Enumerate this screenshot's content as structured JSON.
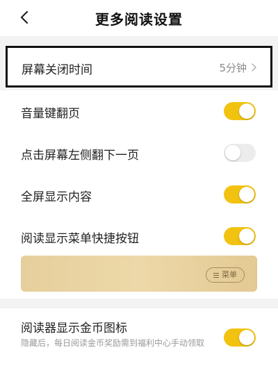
{
  "header": {
    "title": "更多阅读设置"
  },
  "screen_timeout": {
    "label": "屏幕关闭时间",
    "value": "5分钟"
  },
  "settings": [
    {
      "label": "音量键翻页",
      "on": true
    },
    {
      "label": "点击屏幕左侧翻下一页",
      "on": false
    },
    {
      "label": "全屏显示内容",
      "on": true
    },
    {
      "label": "阅读显示菜单快捷按钮",
      "on": true
    },
    {
      "label": "阅读器显示金币图标",
      "on": true,
      "description": "隐藏后，每日阅读金币奖励需到福利中心手动领取"
    }
  ],
  "menu_preview": {
    "button_label": "菜单"
  },
  "colors": {
    "accent": "#f2c210",
    "toggle_off": "#ececec"
  }
}
